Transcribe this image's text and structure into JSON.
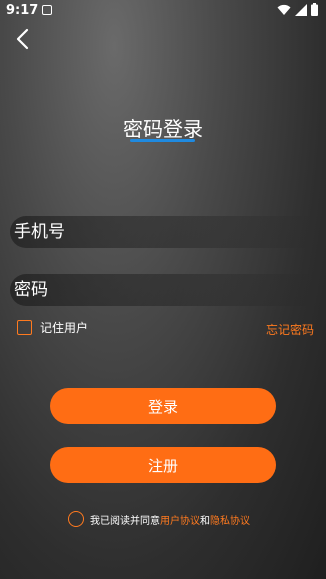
{
  "status": {
    "time": "9:17"
  },
  "page": {
    "title": "密码登录"
  },
  "form": {
    "phone_placeholder": "手机号",
    "password_placeholder": "密码",
    "remember_label": "记住用户",
    "forgot_label": "忘记密码"
  },
  "buttons": {
    "login": "登录",
    "register": "注册"
  },
  "agreement": {
    "prefix": "我已阅读并同意",
    "user_agreement": "用户协议",
    "and": "和",
    "privacy_agreement": "隐私协议"
  },
  "colors": {
    "accent": "#ff6d14",
    "tab_underline": "#1f8ae0"
  },
  "icons": {
    "back": "chevron-left-icon",
    "wifi": "wifi-icon",
    "signal": "signal-icon",
    "battery": "battery-icon",
    "notification": "notification-square-icon"
  }
}
